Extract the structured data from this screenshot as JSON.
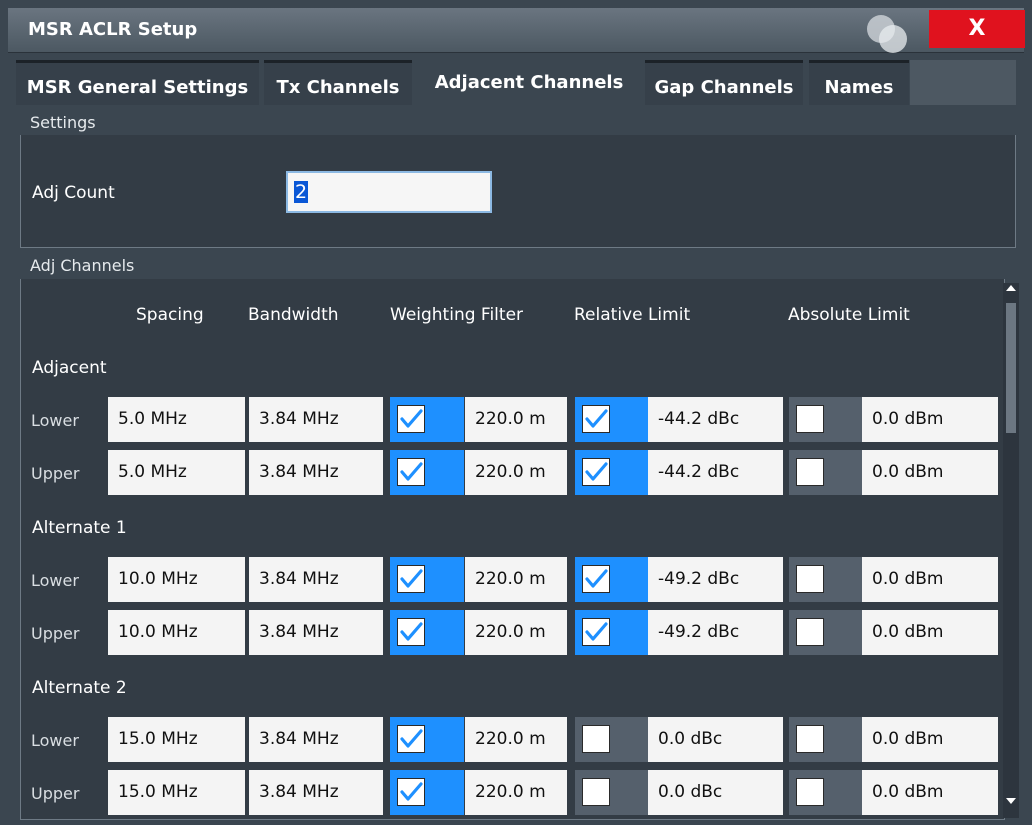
{
  "window": {
    "title": "MSR ACLR Setup",
    "close_label": "X"
  },
  "tabs": [
    {
      "label": "MSR General Settings"
    },
    {
      "label": "Tx Channels"
    },
    {
      "label": "Adjacent Channels"
    },
    {
      "label": "Gap Channels"
    },
    {
      "label": "Names"
    }
  ],
  "settings": {
    "group_label": "Settings",
    "adj_count_label": "Adj Count",
    "adj_count_value": "2"
  },
  "adj_channels": {
    "group_label": "Adj Channels",
    "columns": [
      "Spacing",
      "Bandwidth",
      "Weighting Filter",
      "Relative Limit",
      "Absolute Limit"
    ],
    "sections": [
      {
        "title": "Adjacent",
        "rows": [
          {
            "label": "Lower",
            "spacing": "5.0 MHz",
            "bandwidth": "3.84 MHz",
            "weighting_enabled": true,
            "weighting": "220.0 m",
            "relative_enabled": true,
            "relative": "-44.2 dBc",
            "absolute_enabled": false,
            "absolute": "0.0 dBm"
          },
          {
            "label": "Upper",
            "spacing": "5.0 MHz",
            "bandwidth": "3.84 MHz",
            "weighting_enabled": true,
            "weighting": "220.0 m",
            "relative_enabled": true,
            "relative": "-44.2 dBc",
            "absolute_enabled": false,
            "absolute": "0.0 dBm"
          }
        ]
      },
      {
        "title": "Alternate 1",
        "rows": [
          {
            "label": "Lower",
            "spacing": "10.0 MHz",
            "bandwidth": "3.84 MHz",
            "weighting_enabled": true,
            "weighting": "220.0 m",
            "relative_enabled": true,
            "relative": "-49.2 dBc",
            "absolute_enabled": false,
            "absolute": "0.0 dBm"
          },
          {
            "label": "Upper",
            "spacing": "10.0 MHz",
            "bandwidth": "3.84 MHz",
            "weighting_enabled": true,
            "weighting": "220.0 m",
            "relative_enabled": true,
            "relative": "-49.2 dBc",
            "absolute_enabled": false,
            "absolute": "0.0 dBm"
          }
        ]
      },
      {
        "title": "Alternate 2",
        "rows": [
          {
            "label": "Lower",
            "spacing": "15.0 MHz",
            "bandwidth": "3.84 MHz",
            "weighting_enabled": true,
            "weighting": "220.0 m",
            "relative_enabled": false,
            "relative": "0.0 dBc",
            "absolute_enabled": false,
            "absolute": "0.0 dBm"
          },
          {
            "label": "Upper",
            "spacing": "15.0 MHz",
            "bandwidth": "3.84 MHz",
            "weighting_enabled": true,
            "weighting": "220.0 m",
            "relative_enabled": false,
            "relative": "0.0 dBc",
            "absolute_enabled": false,
            "absolute": "0.0 dBm"
          }
        ]
      }
    ]
  },
  "colors": {
    "accent": "#1e90ff",
    "close": "#e0121e",
    "background": "#3b4650"
  }
}
